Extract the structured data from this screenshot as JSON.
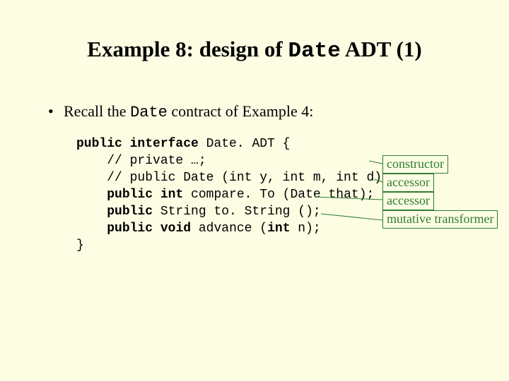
{
  "title": {
    "pre": "Example 8: design of ",
    "mono": "Date",
    "post": " ADT (1)"
  },
  "bullet": {
    "dot": "•",
    "pre": "Recall the ",
    "mono": "Date",
    "post": " contract of Example 4:"
  },
  "code": {
    "l1a": "public",
    "l1b": " ",
    "l1c": "interface",
    "l1d": " Date. ADT {",
    "l2": "    // private …;",
    "l3": "    // public Date (int y, int m, int d);",
    "l4a": "    ",
    "l4b": "public",
    "l4c": " ",
    "l4d": "int",
    "l4e": " compare. To (Date that);",
    "l5a": "    ",
    "l5b": "public",
    "l5c": " String to. String ();",
    "l6a": "    ",
    "l6b": "public",
    "l6c": " ",
    "l6d": "void",
    "l6e": " advance (",
    "l6f": "int",
    "l6g": " n);",
    "l7": "}"
  },
  "labels": {
    "constructor": "constructor",
    "accessor1": "accessor",
    "accessor2": "accessor",
    "mutative": "mutative\ntransformer"
  }
}
